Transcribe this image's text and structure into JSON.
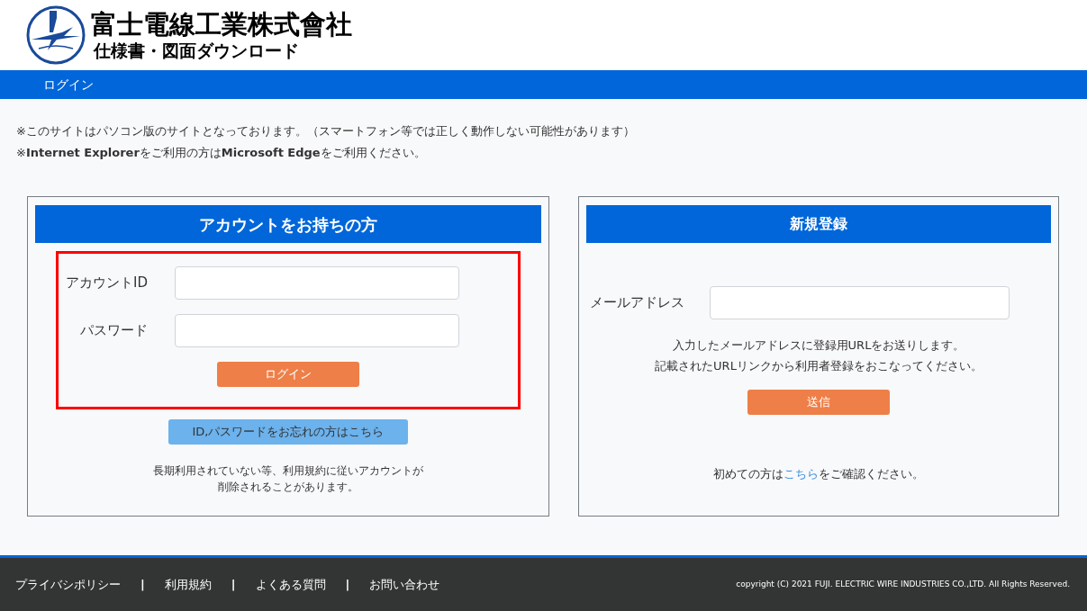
{
  "header": {
    "company": "富士電線工業株式會社",
    "subtitle": "仕様書・図面ダウンロード"
  },
  "nav": {
    "items": [
      {
        "label": "ログイン"
      }
    ]
  },
  "notices": [
    "※このサイトはパソコン版のサイトとなっております。（スマートフォン等では正しく動作しない可能性があります）",
    "※**Internet Explorer**をご利用の方は**Microsoft Edge**をご利用ください。"
  ],
  "login_panel": {
    "title": "アカウントをお持ちの方",
    "highlighted": true,
    "fields": [
      {
        "label": "アカウントID"
      },
      {
        "label": "パスワード"
      }
    ],
    "submit": "ログイン",
    "forgot": "ID,パスワードをお忘れの方はこちら",
    "note": [
      "長期利用されていない等、利用規約に従いアカウントが",
      "削除されることがあります。"
    ]
  },
  "register_panel": {
    "title": "新規登録",
    "field": {
      "label": "メールアドレス"
    },
    "info": [
      "入力したメールアドレスに登録用URLをお送りします。",
      "記載されたURLリンクから利用者登録をおこなってください。"
    ],
    "submit": "送信",
    "first_time": {
      "before": "初めての方は",
      "link": "こちら",
      "after": "をご確認ください。"
    }
  },
  "footer": {
    "items": [
      {
        "kind": "link",
        "text": "プライバシポリシー"
      },
      {
        "kind": "separator",
        "text": "|"
      },
      {
        "kind": "link",
        "text": "利用規約"
      },
      {
        "kind": "separator",
        "text": "|"
      },
      {
        "kind": "link",
        "text": "よくある質問"
      },
      {
        "kind": "separator",
        "text": "|"
      },
      {
        "kind": "link",
        "text": "お問い合わせ"
      }
    ],
    "copyright": "copyright (C) 2021 FUJI. ELECTRIC WIRE INDUSTRIES CO.,LTD. All Rights Reserved."
  }
}
